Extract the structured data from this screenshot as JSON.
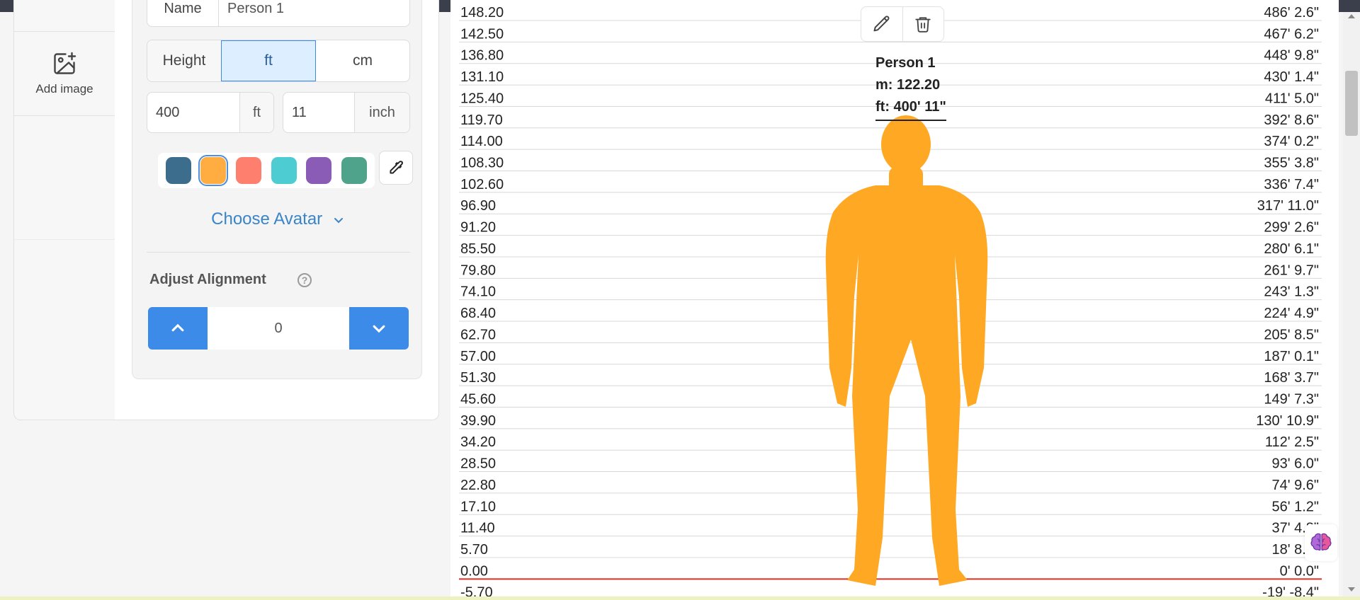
{
  "sidebar": {
    "add_image_label": "Add image"
  },
  "form": {
    "name_label": "Name",
    "name_value": "Person 1",
    "height_label": "Height",
    "unit_options": [
      "ft",
      "cm"
    ],
    "selected_unit": "ft",
    "feet_value": "400",
    "feet_unit": "ft",
    "inch_value": "11",
    "inch_unit": "inch",
    "colors": [
      "#3d6d8c",
      "#ffad41",
      "#fe7f6e",
      "#4dcdd1",
      "#8a5cb5",
      "#4fa38a"
    ],
    "selected_color": "#ffad41",
    "choose_avatar_label": "Choose Avatar",
    "adjust_alignment_label": "Adjust Alignment",
    "alignment_value": "0"
  },
  "chart": {
    "baseline_color": "#d93025",
    "grid_color": "#d8d8d8",
    "rows": [
      {
        "m": "148.20",
        "ft": "486' 2.6\""
      },
      {
        "m": "142.50",
        "ft": "467' 6.2\""
      },
      {
        "m": "136.80",
        "ft": "448' 9.8\""
      },
      {
        "m": "131.10",
        "ft": "430' 1.4\""
      },
      {
        "m": "125.40",
        "ft": "411' 5.0\""
      },
      {
        "m": "119.70",
        "ft": "392' 8.6\""
      },
      {
        "m": "114.00",
        "ft": "374' 0.2\""
      },
      {
        "m": "108.30",
        "ft": "355' 3.8\""
      },
      {
        "m": "102.60",
        "ft": "336' 7.4\""
      },
      {
        "m": "96.90",
        "ft": "317' 11.0\""
      },
      {
        "m": "91.20",
        "ft": "299' 2.6\""
      },
      {
        "m": "85.50",
        "ft": "280' 6.1\""
      },
      {
        "m": "79.80",
        "ft": "261' 9.7\""
      },
      {
        "m": "74.10",
        "ft": "243' 1.3\""
      },
      {
        "m": "68.40",
        "ft": "224' 4.9\""
      },
      {
        "m": "62.70",
        "ft": "205' 8.5\""
      },
      {
        "m": "57.00",
        "ft": "187' 0.1\""
      },
      {
        "m": "51.30",
        "ft": "168' 3.7\""
      },
      {
        "m": "45.60",
        "ft": "149' 7.3\""
      },
      {
        "m": "39.90",
        "ft": "130' 10.9\""
      },
      {
        "m": "34.20",
        "ft": "112' 2.5\""
      },
      {
        "m": "28.50",
        "ft": "93' 6.0\""
      },
      {
        "m": "22.80",
        "ft": "74' 9.6\""
      },
      {
        "m": "17.10",
        "ft": "56' 1.2\""
      },
      {
        "m": "11.40",
        "ft": "37' 4.8\""
      },
      {
        "m": "5.70",
        "ft": "18' 8.4\""
      },
      {
        "m": "0.00",
        "ft": "0' 0.0\""
      },
      {
        "m": "-5.70",
        "ft": "-19' -8.4\""
      }
    ]
  },
  "person": {
    "name": "Person 1",
    "m_text": "m: 122.20",
    "ft_text": "ft: 400' 11\"",
    "color": "#ffa823"
  },
  "icons": {
    "edit": "pencil-icon",
    "delete": "trash-icon",
    "picker": "eyedropper-icon",
    "help": "question-icon",
    "brain": "brain-icon"
  }
}
